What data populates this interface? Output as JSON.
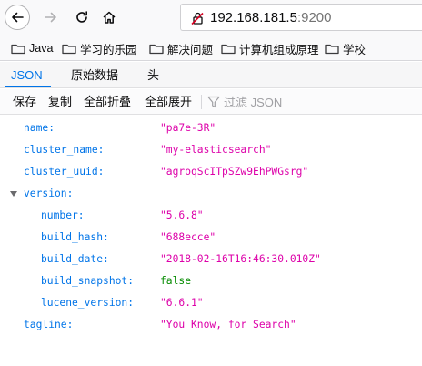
{
  "nav": {
    "url_host": "192.168.181.5",
    "url_port": ":9200"
  },
  "bookmarks": [
    {
      "label": "Java"
    },
    {
      "label": "学习的乐园"
    },
    {
      "label": "解决问题"
    },
    {
      "label": "计算机组成原理"
    },
    {
      "label": "学校"
    }
  ],
  "tabs": [
    {
      "label": "JSON",
      "selected": true
    },
    {
      "label": "原始数据",
      "selected": false
    },
    {
      "label": "头",
      "selected": false
    }
  ],
  "toolbar": {
    "save": "保存",
    "copy": "复制",
    "collapse_all": "全部折叠",
    "expand_all": "全部展开",
    "filter_placeholder": "过滤 JSON"
  },
  "json": {
    "name": {
      "key": "name:",
      "value": "\"pa7e-3R\""
    },
    "cluster_name": {
      "key": "cluster_name:",
      "value": "\"my-elasticsearch\""
    },
    "cluster_uuid": {
      "key": "cluster_uuid:",
      "value": "\"agroqScITpSZw9EhPWGsrg\""
    },
    "version": {
      "key": "version:",
      "expanded": true,
      "number": {
        "key": "number:",
        "value": "\"5.6.8\""
      },
      "build_hash": {
        "key": "build_hash:",
        "value": "\"688ecce\""
      },
      "build_date": {
        "key": "build_date:",
        "value": "\"2018-02-16T16:46:30.010Z\""
      },
      "build_snapshot": {
        "key": "build_snapshot:",
        "value": "false"
      },
      "lucene_version": {
        "key": "lucene_version:",
        "value": "\"6.6.1\""
      }
    },
    "tagline": {
      "key": "tagline:",
      "value": "\"You Know, for Search\""
    }
  },
  "colors": {
    "key": "#0074e8",
    "string": "#dd00a9",
    "boolean": "#058b00",
    "accent": "#0074e8"
  },
  "icons": [
    "back-arrow-icon",
    "forward-arrow-icon",
    "reload-icon",
    "home-icon",
    "insecure-connection-icon",
    "folder-icon",
    "filter-icon",
    "twisty-expanded-icon"
  ]
}
